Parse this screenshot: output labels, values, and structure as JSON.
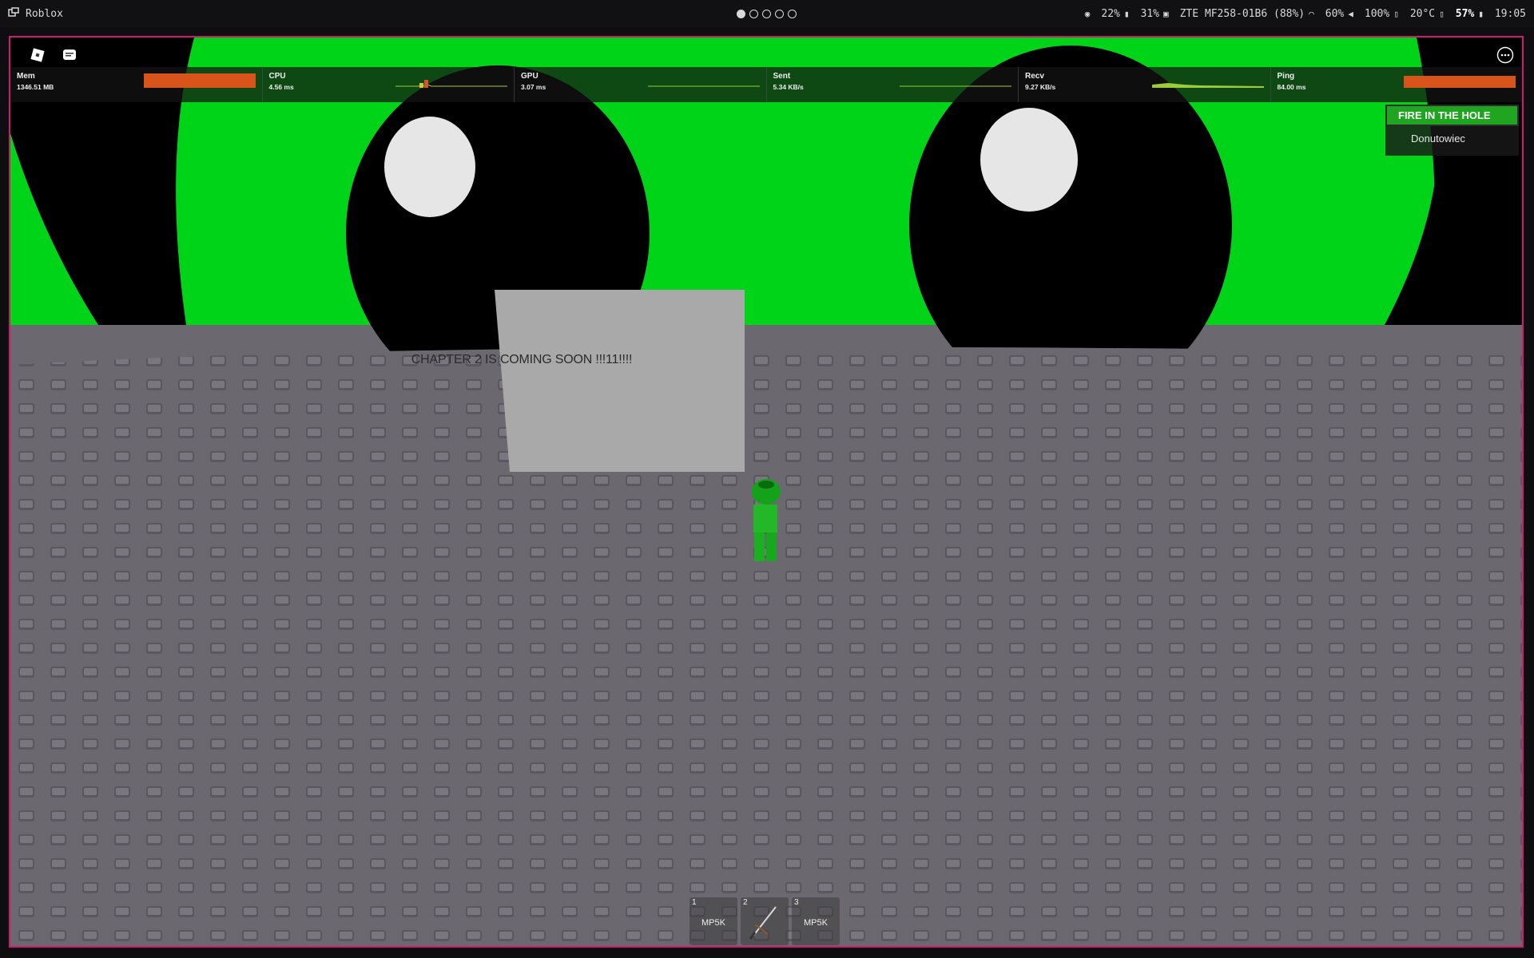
{
  "topbar": {
    "app_title": "Roblox",
    "workspaces": [
      true,
      false,
      false,
      false,
      false
    ],
    "indicators": {
      "cpu": "22%",
      "memory": "31%",
      "network": "ZTE MF258-01B6 (88%)",
      "brightness": "60%",
      "volume": "100%",
      "temperature": "20°C",
      "battery": "57%",
      "clock": "19:05"
    }
  },
  "stats": [
    {
      "label": "Mem",
      "value": "1346.51 MB",
      "graph": "bar-full",
      "color": "#d9541a"
    },
    {
      "label": "CPU",
      "value": "4.56 ms",
      "graph": "spikes",
      "color": "#c8d130"
    },
    {
      "label": "GPU",
      "value": "3.07 ms",
      "graph": "flat",
      "color": "#9ccc3a"
    },
    {
      "label": "Sent",
      "value": "5.34 KB/s",
      "graph": "flat",
      "color": "#9ccc3a"
    },
    {
      "label": "Recv",
      "value": "9.27 KB/s",
      "graph": "bump",
      "color": "#9ccc3a"
    },
    {
      "label": "Ping",
      "value": "84.00 ms",
      "graph": "bar-full",
      "color": "#d9541a"
    }
  ],
  "leaderboard": {
    "header": "FIRE IN THE HOLE",
    "players": [
      "Donutowiec"
    ]
  },
  "sign": {
    "text": "CHAPTER 2  IS COMING SOON !!!11!!!!"
  },
  "hotbar": [
    {
      "num": "1",
      "name": "MP5K"
    },
    {
      "num": "2",
      "name": "",
      "icon": "sword-icon"
    },
    {
      "num": "3",
      "name": "MP5K"
    }
  ],
  "colors": {
    "frame_border": "#d01a6e",
    "sky_green": "#00d418",
    "baseplate": "#6c6870",
    "leaderboard_header": "#1fa51f"
  }
}
